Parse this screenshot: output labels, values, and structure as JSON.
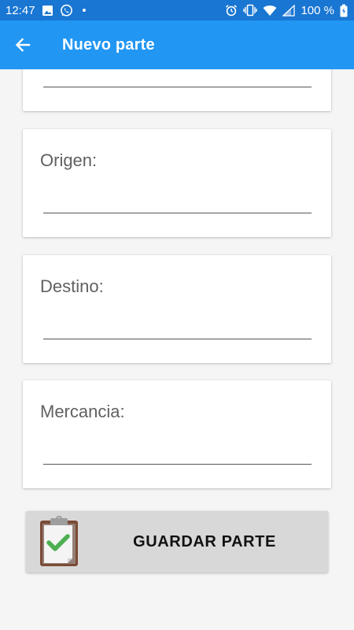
{
  "status_bar": {
    "time": "12:47",
    "battery_percent": "100 %",
    "icons": [
      "image-icon",
      "whatsapp-icon",
      "dot-icon",
      "alarm-icon",
      "vibrate-icon",
      "wifi-icon",
      "signal-icon",
      "battery-icon"
    ],
    "background_color": "#1976d2"
  },
  "app_bar": {
    "title": "Nuevo parte",
    "back_icon": "arrow-back-icon",
    "background_color": "#2196f3"
  },
  "form": {
    "fields": [
      {
        "label": "",
        "value": ""
      },
      {
        "label": "Origen:",
        "value": ""
      },
      {
        "label": "Destino:",
        "value": ""
      },
      {
        "label": "Mercancia:",
        "value": ""
      }
    ]
  },
  "save_button": {
    "label": "GUARDAR PARTE",
    "icon": "clipboard-check-icon"
  }
}
